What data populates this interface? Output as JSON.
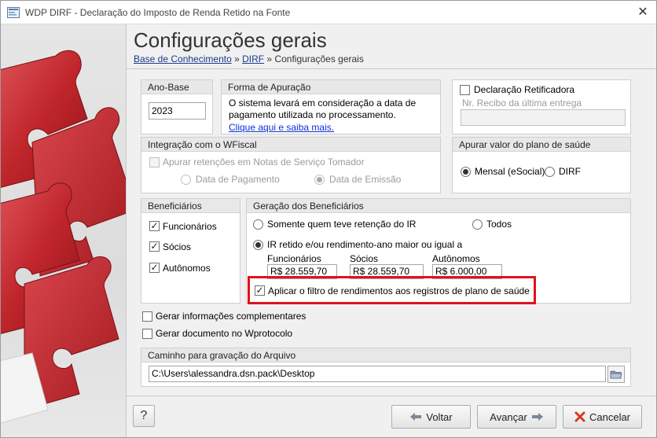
{
  "window": {
    "title": "WDP DIRF - Declaração do Imposto de Renda Retido na Fonte",
    "close_glyph": "✕"
  },
  "header": {
    "title": "Configurações gerais",
    "breadcrumb": {
      "item1": "Base de Conhecimento",
      "sep1": " » ",
      "item2": "DIRF",
      "sep2": " » ",
      "item3": "Configurações gerais"
    }
  },
  "ano_base": {
    "title": "Ano-Base",
    "value": "2023"
  },
  "forma_apuracao": {
    "title": "Forma de Apuração",
    "line1": "O sistema levará em consideração a data de",
    "line2": "pagamento utilizada no processamento.",
    "link": "Clique aqui e saiba mais."
  },
  "declaracao_retificadora": {
    "label": "Declaração Retificadora",
    "recibo_label": "Nr. Recibo da última entrega",
    "recibo_value": ""
  },
  "integracao": {
    "title": "Integração com o WFiscal",
    "checkbox_label": "Apurar retenções em Notas de Serviço Tomador",
    "radio_pagamento": "Data de Pagamento",
    "radio_emissao": "Data de Emissão"
  },
  "plano_saude": {
    "title": "Apurar valor do plano de saúde",
    "radio_mensal": "Mensal (eSocial)",
    "radio_dirf": "DIRF"
  },
  "beneficiarios": {
    "title": "Beneficiários",
    "funcionarios": "Funcionários",
    "socios": "Sócios",
    "autonomos": "Autônomos"
  },
  "geracao": {
    "title": "Geração dos Beneficiários",
    "radio_somente": "Somente quem teve retenção do IR",
    "radio_todos": "Todos",
    "radio_ir": "IR retido e/ou rendimento-ano maior ou igual a",
    "func_label": "Funcionários",
    "func_value": "R$ 28.559,70",
    "socios_label": "Sócios",
    "socios_value": "R$ 28.559,70",
    "autonomos_label": "Autônomos",
    "autonomos_value": "R$ 6.000,00",
    "filtro_label": "Aplicar o filtro de rendimentos aos registros de plano de saúde"
  },
  "options": {
    "gerar_info": "Gerar informações complementares",
    "gerar_doc": "Gerar documento no Wprotocolo"
  },
  "caminho": {
    "title": "Caminho para gravação do Arquivo",
    "value": "C:\\Users\\alessandra.dsn.pack\\Desktop"
  },
  "footer": {
    "help": "?",
    "voltar": "Voltar",
    "avancar": "Avançar",
    "cancelar": "Cancelar"
  },
  "colors": {
    "highlight": "#e0111b",
    "link": "#0b2fd8",
    "puzzle_red": "#c0262c",
    "cancel_x": "#d43a1f"
  },
  "icons": [
    "app-icon",
    "close-icon",
    "puzzle-image",
    "folder-icon",
    "help-icon",
    "arrow-left-icon",
    "arrow-right-icon",
    "cancel-x-icon"
  ]
}
